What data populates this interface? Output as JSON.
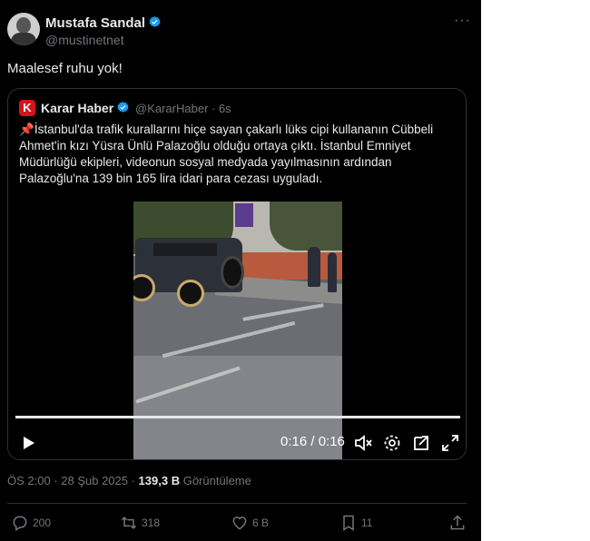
{
  "author": {
    "name": "Mustafa Sandal",
    "handle": "@mustinetnet",
    "verified": true
  },
  "tweet": {
    "text": "Maalesef ruhu yok!"
  },
  "quote": {
    "logo_letter": "K",
    "name": "Karar Haber",
    "meta": "@KararHaber · 6s",
    "text": "İstanbul'da trafik kurallarını hiçe sayan çakarlı lüks cipi kullananın Cübbeli Ahmet'in kızı Yüsra Ünlü Palazoğlu olduğu ortaya çıktı. İstanbul Emniyet Müdürlüğü ekipleri, videonun sosyal medyada yayılmasının ardından Palazoğlu'na 139 bin 165 lira idari para cezası uyguladı.",
    "video": {
      "time": "0:16 / 0:16",
      "progress": 1.0
    }
  },
  "footer": {
    "timestamp": "ÖS 2:00 · 28 Şub 2025 · ",
    "views_count": "139,3 B",
    "views_label": " Görüntüleme"
  },
  "actions": {
    "replies": "200",
    "reposts": "318",
    "likes": "6 B",
    "bookmarks": "11"
  },
  "colors": {
    "background": "#000000",
    "text": "#e7e9ea",
    "muted": "#71767b",
    "verified": "#1d9bf0",
    "brand_red": "#d4131b"
  }
}
